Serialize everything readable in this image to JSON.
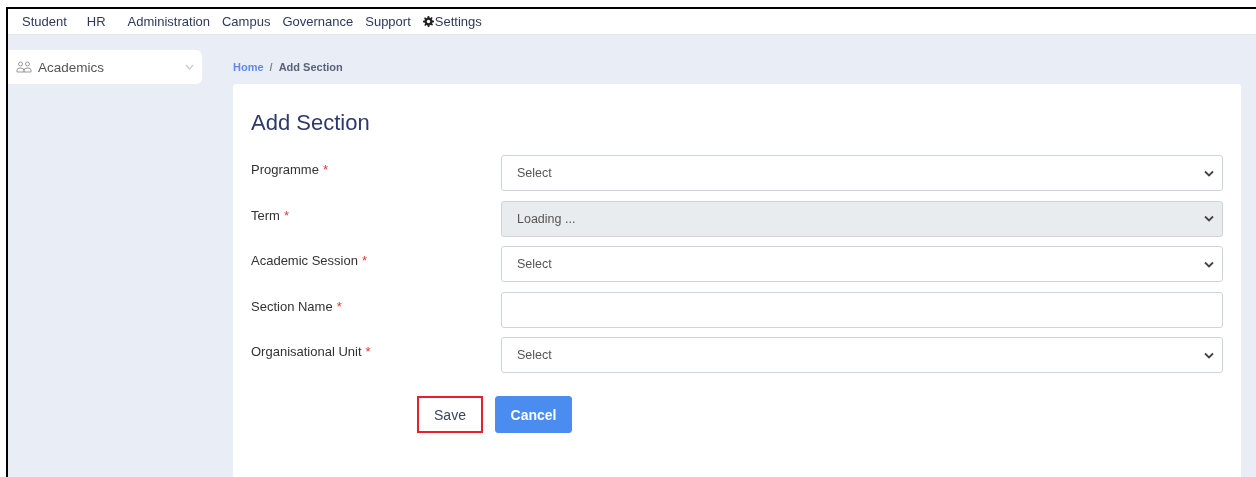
{
  "top_nav": [
    {
      "label": "Student",
      "kind": "menu"
    },
    {
      "label": "HR",
      "kind": "menu"
    },
    {
      "label": "Administration",
      "kind": "menu"
    },
    {
      "label": "Campus",
      "kind": "menu"
    },
    {
      "label": "Governance",
      "kind": "menu"
    },
    {
      "label": "Support",
      "kind": "menu"
    },
    {
      "label": "Settings",
      "kind": "settings"
    }
  ],
  "sidebar": {
    "items": [
      {
        "label": "Academics",
        "expanded": false
      }
    ]
  },
  "breadcrumb": [
    {
      "label": "Home",
      "kind": "link"
    },
    {
      "label": "/",
      "kind": "separator"
    },
    {
      "label": "Add Section",
      "kind": "current"
    }
  ],
  "form": {
    "title": "Add Section",
    "fields": [
      {
        "label": "Programme",
        "required_mark": "*",
        "kind": "select",
        "value": "Select",
        "disabled": false
      },
      {
        "label": "Term",
        "required_mark": "*",
        "kind": "select",
        "value": "Loading ...",
        "disabled": true
      },
      {
        "label": "Academic Session",
        "required_mark": "*",
        "kind": "select",
        "value": "Select",
        "disabled": false
      },
      {
        "label": "Section Name",
        "required_mark": "*",
        "kind": "text",
        "disabled": false
      },
      {
        "label": "Organisational Unit",
        "required_mark": "*",
        "kind": "select",
        "value": "Select",
        "disabled": false
      }
    ],
    "buttons": [
      {
        "label": "Save",
        "kind": "secondary",
        "highlighted": true
      },
      {
        "label": "Cancel",
        "kind": "primary",
        "highlighted": false
      }
    ]
  }
}
